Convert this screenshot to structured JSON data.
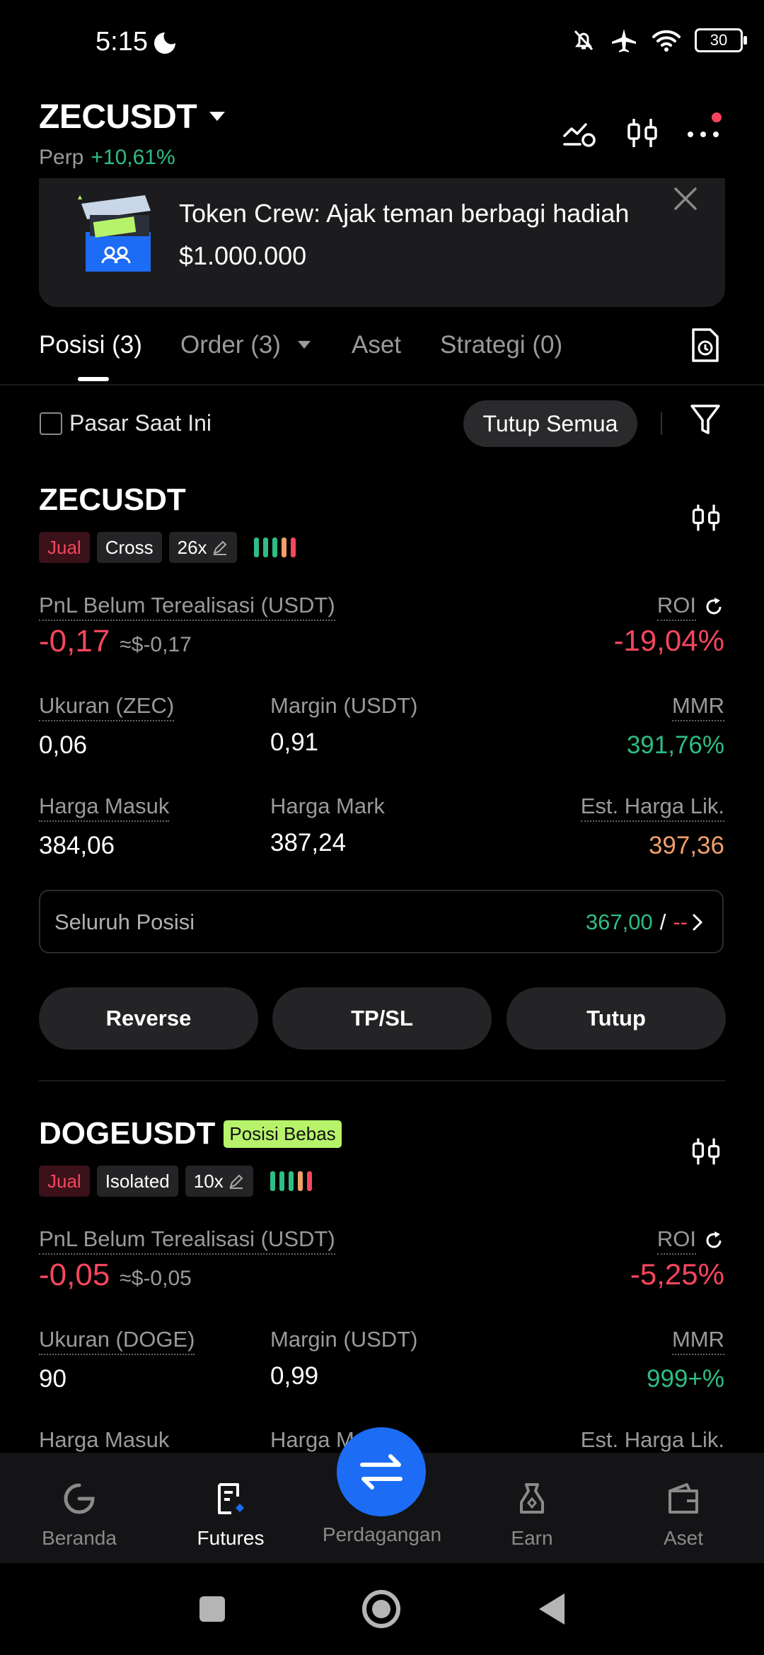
{
  "status_bar": {
    "time": "5:15",
    "battery": "30"
  },
  "header": {
    "symbol": "ZECUSDT",
    "contract_type": "Perp",
    "change": "+10,61%"
  },
  "banner": {
    "text": "Token Crew: Ajak teman berbagi hadiah $1.000.000"
  },
  "tabs": [
    {
      "label": "Posisi (3)"
    },
    {
      "label": "Order (3)"
    },
    {
      "label": "Aset"
    },
    {
      "label": "Strategi (0)"
    }
  ],
  "filter": {
    "checkbox_label": "Pasar Saat Ini",
    "close_all": "Tutup Semua"
  },
  "positions": [
    {
      "symbol": "ZECUSDT",
      "side": "Jual",
      "margin_mode": "Cross",
      "leverage": "26x",
      "pnl_label": "PnL Belum Terealisasi (USDT)",
      "pnl": "-0,17",
      "pnl_usd": "≈$-0,17",
      "roi_label": "ROI",
      "roi": "-19,04%",
      "size_label": "Ukuran (ZEC)",
      "size": "0,06",
      "margin_label": "Margin (USDT)",
      "margin": "0,91",
      "mmr_label": "MMR",
      "mmr": "391,76%",
      "entry_label": "Harga Masuk",
      "entry": "384,06",
      "mark_label": "Harga Mark",
      "mark": "387,24",
      "liq_label": "Est. Harga Lik.",
      "liq": "397,36",
      "whole_label": "Seluruh Posisi",
      "whole_value": "367,00",
      "whole_sep": "/",
      "whole_dash": "--",
      "buttons": {
        "reverse": "Reverse",
        "tpsl": "TP/SL",
        "close": "Tutup"
      }
    },
    {
      "symbol": "DOGEUSDT",
      "badge": "Posisi Bebas",
      "side": "Jual",
      "margin_mode": "Isolated",
      "leverage": "10x",
      "pnl_label": "PnL Belum Terealisasi (USDT)",
      "pnl": "-0,05",
      "pnl_usd": "≈$-0,05",
      "roi_label": "ROI",
      "roi": "-5,25%",
      "size_label": "Ukuran (DOGE)",
      "size": "90",
      "margin_label": "Margin (USDT)",
      "margin": "0,99",
      "mmr_label": "MMR",
      "mmr": "999+%",
      "entry_label": "Harga Masuk",
      "mark_label": "Harga Mark",
      "liq_label": "Est. Harga Lik."
    }
  ],
  "bottom_nav": [
    {
      "label": "Beranda"
    },
    {
      "label": "Futures"
    },
    {
      "label": "Perdagangan"
    },
    {
      "label": "Earn"
    },
    {
      "label": "Aset"
    }
  ],
  "colors": {
    "green": "#2ebd85",
    "red": "#f6465d",
    "orange": "#f0a06a",
    "accent": "#1c6cf5",
    "badge": "#b6f36a"
  }
}
